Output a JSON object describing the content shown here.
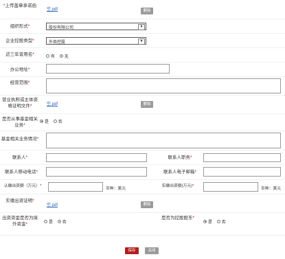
{
  "rows": {
    "seal_upload": {
      "label_star": "*",
      "label": "上传盖章承诺函",
      "file": "空.pdf",
      "delete": "删除"
    },
    "org_form": {
      "label": "组织形式",
      "star": "*",
      "value": "股份有限公司",
      "arrow": "▼"
    },
    "ownership": {
      "label": "企业控股类型",
      "star": "*",
      "value": "外商控股",
      "arrow": "▼"
    },
    "used_name": {
      "label": "近三年曾用名",
      "star": "*",
      "opt_yes": "有",
      "opt_no": "无"
    },
    "office_addr": {
      "label": "办公地址",
      "star": "*",
      "value": ""
    },
    "biz_scope": {
      "label": "经营范围",
      "star": "*",
      "value": ""
    },
    "license": {
      "label": "营业执照或主体资格证明文件",
      "star": "*",
      "file": "空.pdf",
      "delete": "删除"
    },
    "fund_biz": {
      "label": "是否从事基金相关业务",
      "star": "*",
      "opt_yes": "是",
      "opt_no": "否"
    },
    "fund_desc": {
      "label": "基金相关业务情况",
      "star": "*",
      "value": ""
    },
    "contact": {
      "label": "联系人",
      "star": "*",
      "value": "",
      "role_label": "联系人职务",
      "role_star": "*",
      "role_value": ""
    },
    "phone": {
      "label": "联系人移动电话",
      "star": "*",
      "value": "",
      "email_label": "联系人电子邮箱",
      "email_star": "*",
      "email_value": ""
    },
    "capital": {
      "label": "认缴出资额（万元）",
      "star": "*",
      "value": "",
      "currency": "币种：美元",
      "paid_label": "实缴出资额(万元)",
      "paid_star": "*",
      "paid_value": "",
      "paid_currency": "币种：美元"
    },
    "paid_proof": {
      "label": "实缴出资证明",
      "star": "*",
      "file": "空.pdf",
      "delete": "删除"
    },
    "overseas": {
      "label": "出资资金是否为境外资金",
      "star": "*",
      "opt_yes": "是",
      "opt_no": "否",
      "holding_label": "是否为控股股东",
      "holding_star": "*",
      "h_yes": "是",
      "h_no": "否"
    }
  },
  "actions": {
    "save": "保存",
    "close": "关闭"
  }
}
